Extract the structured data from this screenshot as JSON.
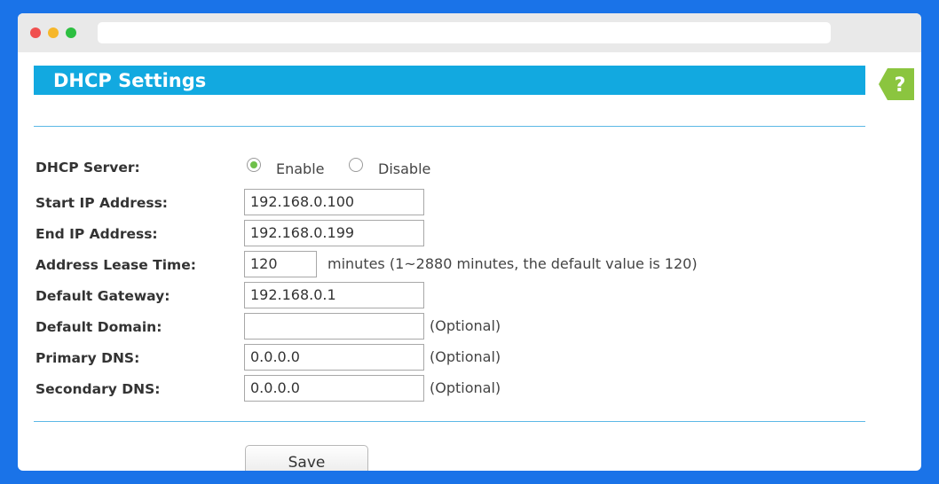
{
  "page": {
    "title": "DHCP Settings",
    "help_icon": "question-mark-icon",
    "accent_color": "#12a9e0",
    "background_color": "#1a73e8"
  },
  "dhcp_server": {
    "label": "DHCP Server:",
    "options": [
      {
        "label": "Enable",
        "checked": true
      },
      {
        "label": "Disable",
        "checked": false
      }
    ]
  },
  "fields": {
    "start_ip": {
      "label": "Start IP Address:",
      "value": "192.168.0.100"
    },
    "end_ip": {
      "label": "End IP Address:",
      "value": "192.168.0.199"
    },
    "lease_time": {
      "label": "Address Lease Time:",
      "value": "120",
      "note": "minutes (1~2880 minutes, the default value is 120)"
    },
    "gateway": {
      "label": "Default Gateway:",
      "value": "192.168.0.1"
    },
    "domain": {
      "label": "Default Domain:",
      "value": "",
      "note": "(Optional)"
    },
    "primary_dns": {
      "label": "Primary DNS:",
      "value": "0.0.0.0",
      "note": "(Optional)"
    },
    "secondary_dns": {
      "label": "Secondary DNS:",
      "value": "0.0.0.0",
      "note": "(Optional)"
    }
  },
  "actions": {
    "save_label": "Save"
  }
}
